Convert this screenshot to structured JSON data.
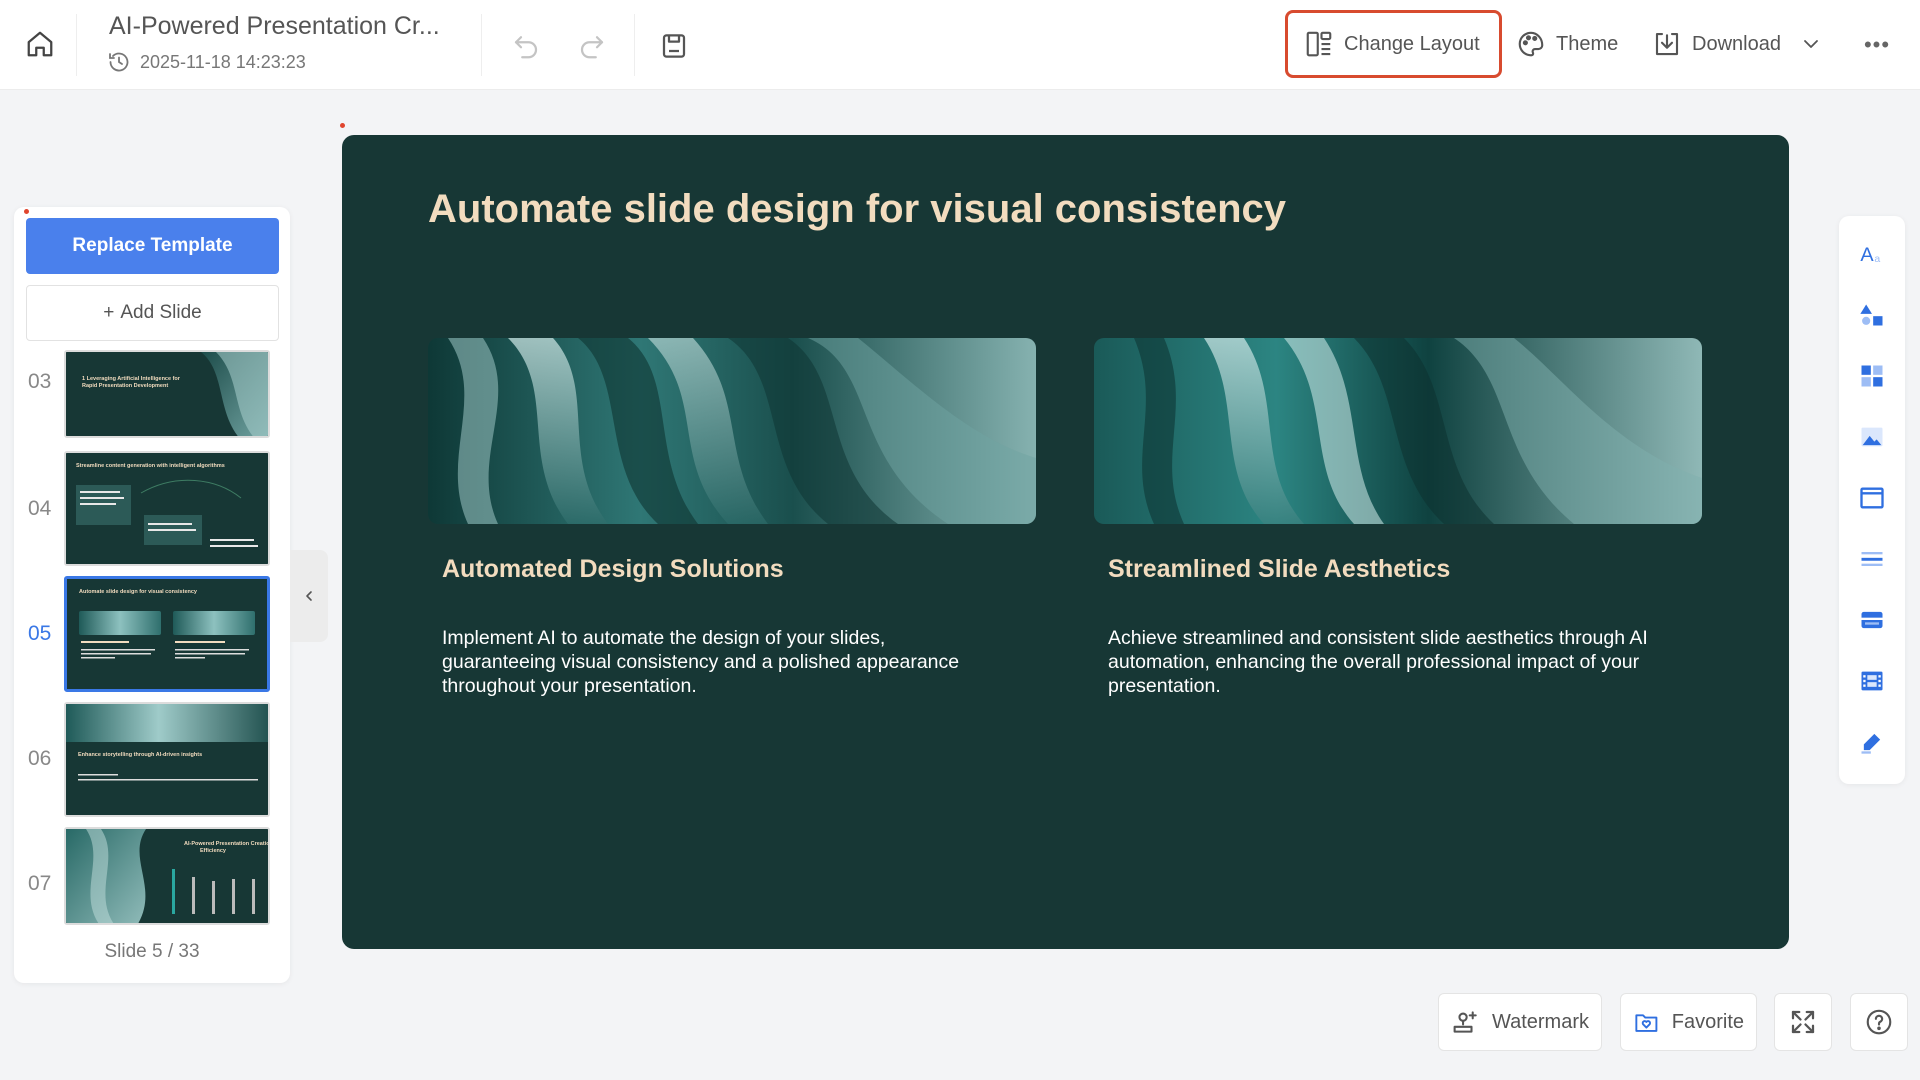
{
  "header": {
    "doc_title": "AI-Powered Presentation Cr...",
    "timestamp": "2025-11-18 14:23:23",
    "change_layout": "Change Layout",
    "theme": "Theme",
    "download": "Download",
    "highlight_color": "#d84b2f"
  },
  "sidebar": {
    "replace_template": "Replace Template",
    "add_slide": "Add Slide",
    "add_symbol": "+",
    "thumbnails": [
      {
        "num": "03",
        "title": "1 Leveraging Artificial Intelligence for Rapid Presentation Development"
      },
      {
        "num": "04",
        "title": "Streamline content generation with intelligent algorithms"
      },
      {
        "num": "05",
        "title": "Automate slide design for visual consistency"
      },
      {
        "num": "06",
        "title": "Enhance storytelling through AI-driven insights"
      },
      {
        "num": "07",
        "title": "AI-Powered Presentation Creation Efficiency"
      }
    ],
    "active_thumbnail": "05",
    "slide_counter": "Slide 5 / 33",
    "accent_color": "#3a78e6"
  },
  "slide": {
    "title": "Automate slide design for visual consistency",
    "background_color": "#173735",
    "heading_color": "#f2dcbf",
    "cards": [
      {
        "heading": "Automated Design Solutions",
        "body": "Implement AI to automate the design of your slides, guaranteeing visual consistency and a polished appearance throughout your presentation."
      },
      {
        "heading": "Streamlined Slide Aesthetics",
        "body": "Achieve streamlined and consistent slide aesthetics through AI automation, enhancing the overall professional impact of your presentation."
      }
    ]
  },
  "right_toolbar": {
    "items": [
      "text-icon",
      "shapes-icon",
      "elements-icon",
      "image-icon",
      "frame-icon",
      "divider-icon",
      "table-icon",
      "media-icon",
      "draw-icon"
    ]
  },
  "footer": {
    "watermark": "Watermark",
    "favorite": "Favorite"
  }
}
